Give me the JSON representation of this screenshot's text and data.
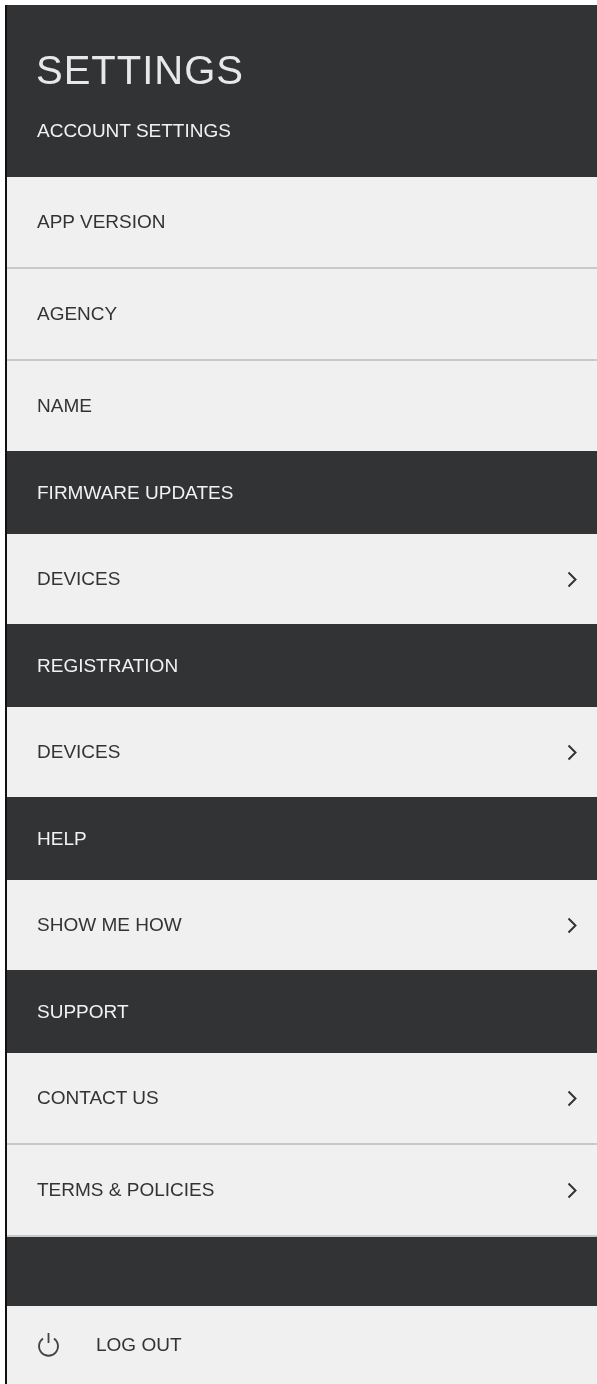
{
  "title": "SETTINGS",
  "sections": [
    {
      "header": "ACCOUNT SETTINGS",
      "items": [
        {
          "label": "APP VERSION",
          "chevron": false
        },
        {
          "label": "AGENCY",
          "chevron": false
        },
        {
          "label": "NAME",
          "chevron": false
        }
      ]
    },
    {
      "header": "FIRMWARE UPDATES",
      "items": [
        {
          "label": "DEVICES",
          "chevron": true
        }
      ]
    },
    {
      "header": "REGISTRATION",
      "items": [
        {
          "label": "DEVICES",
          "chevron": true
        }
      ]
    },
    {
      "header": "HELP",
      "items": [
        {
          "label": "SHOW ME HOW",
          "chevron": true
        }
      ]
    },
    {
      "header": "SUPPORT",
      "items": [
        {
          "label": "CONTACT US",
          "chevron": true
        },
        {
          "label": "TERMS & POLICIES",
          "chevron": true
        }
      ]
    }
  ],
  "logout": {
    "label": "LOG OUT"
  }
}
